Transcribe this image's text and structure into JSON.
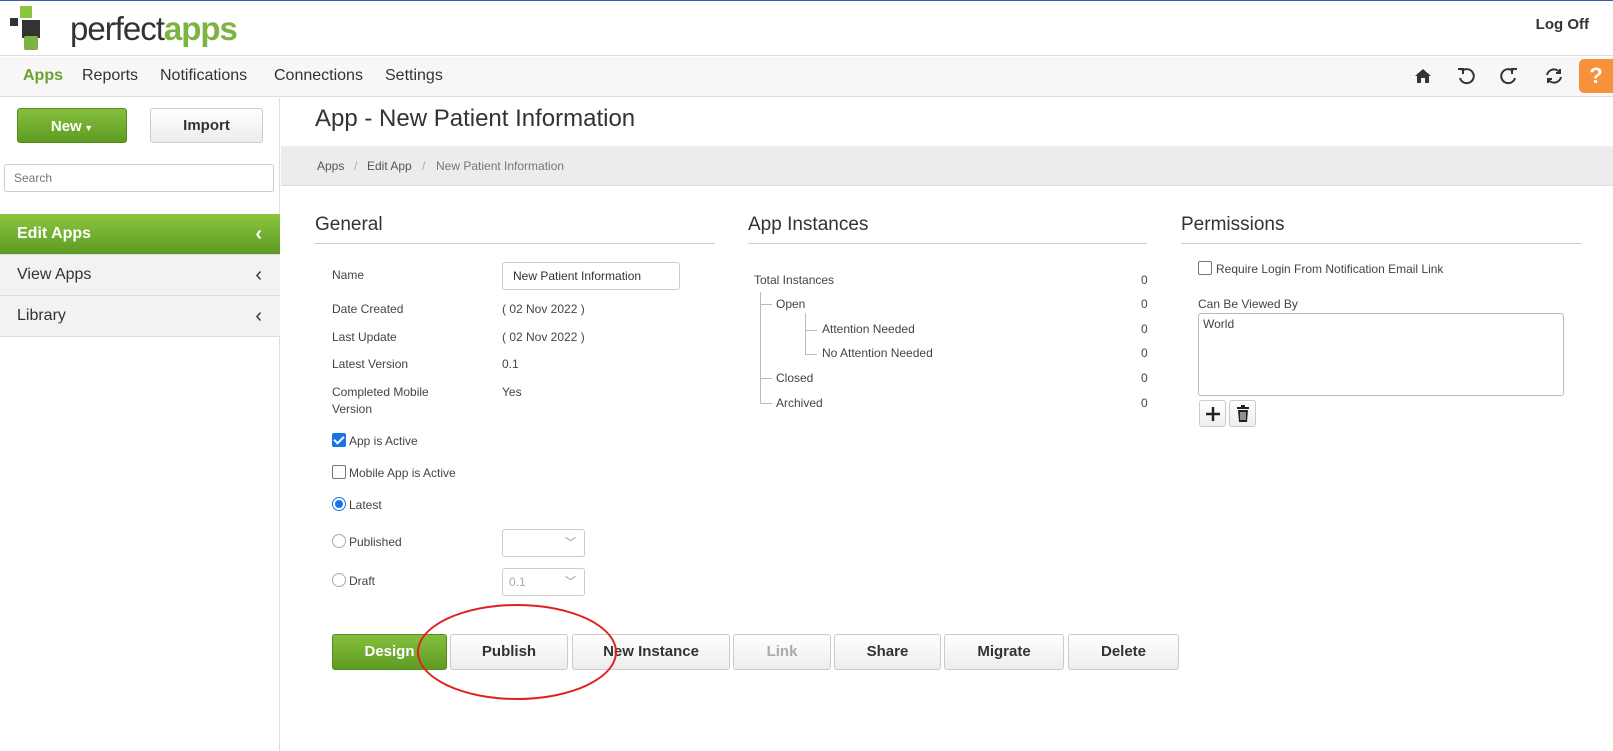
{
  "header": {
    "logo_text_1": "perfect",
    "logo_text_2": "apps",
    "logoff": "Log Off"
  },
  "nav": {
    "items": [
      "Apps",
      "Reports",
      "Notifications",
      "Connections",
      "Settings"
    ],
    "icons": [
      "home-icon",
      "undo-icon",
      "redo-icon",
      "refresh-icon"
    ],
    "help": "?"
  },
  "sidebar": {
    "new_label": "New",
    "import_label": "Import",
    "search_placeholder": "Search",
    "items": [
      {
        "label": "Edit Apps"
      },
      {
        "label": "View Apps"
      },
      {
        "label": "Library"
      }
    ]
  },
  "page": {
    "title": "App - New Patient Information",
    "breadcrumb": [
      "Apps",
      "Edit App",
      "New Patient Information"
    ]
  },
  "general": {
    "title": "General",
    "name_label": "Name",
    "name_value": "New Patient Information",
    "date_created_label": "Date Created",
    "date_created": "( 02 Nov 2022 )",
    "last_update_label": "Last Update",
    "last_update": "( 02 Nov 2022 )",
    "latest_version_label": "Latest Version",
    "latest_version": "0.1",
    "completed_mobile_label_1": "Completed Mobile",
    "completed_mobile_label_2": "Version",
    "completed_mobile": "Yes",
    "app_active_label": "App is Active",
    "mobile_active_label": "Mobile App is Active",
    "latest_label": "Latest",
    "published_label": "Published",
    "published_value": "",
    "draft_label": "Draft",
    "draft_value": "0.1"
  },
  "instances": {
    "title": "App Instances",
    "rows": [
      {
        "label": "Total Instances",
        "value": "0"
      },
      {
        "label": "Open",
        "value": "0"
      },
      {
        "label": "Attention Needed",
        "value": "0"
      },
      {
        "label": "No Attention Needed",
        "value": "0"
      },
      {
        "label": "Closed",
        "value": "0"
      },
      {
        "label": "Archived",
        "value": "0"
      }
    ]
  },
  "permissions": {
    "title": "Permissions",
    "require_login_label": "Require Login From Notification Email Link",
    "viewed_by_label": "Can Be Viewed By",
    "viewed_by_items": [
      "World"
    ]
  },
  "actions": [
    "Design",
    "Publish",
    "New Instance",
    "Link",
    "Share",
    "Migrate",
    "Delete"
  ],
  "colors": {
    "brand_green": "#7cb342",
    "accent_orange": "#f6923a",
    "annotation_red": "#e02020",
    "checkbox_blue": "#1a73e8"
  }
}
